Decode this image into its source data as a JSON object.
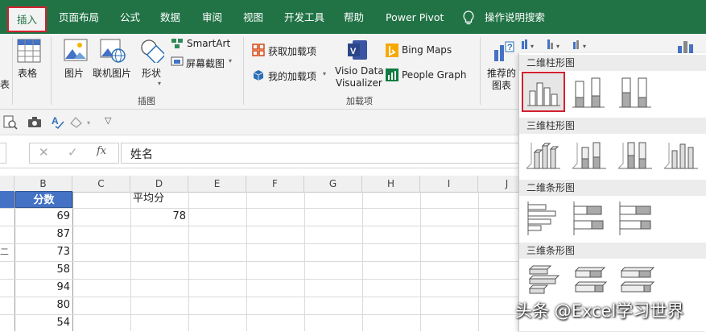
{
  "tabs": [
    "插入",
    "页面布局",
    "公式",
    "数据",
    "审阅",
    "视图",
    "开发工具",
    "帮助",
    "Power Pivot"
  ],
  "tell_me": "操作说明搜索",
  "ribbon": {
    "table_partial": "表",
    "table": "表格",
    "picture": "图片",
    "online_picture": "联机图片",
    "shapes": "形状",
    "smartart": "SmartArt",
    "screenshot": "屏幕截图",
    "group_illustrations": "插图",
    "get_addins": "获取加载项",
    "my_addins": "我的加载项",
    "visio_line1": "Visio Data",
    "visio_line2": "Visualizer",
    "bing_maps": "Bing Maps",
    "people_graph": "People Graph",
    "group_addins": "加载项",
    "recommended_line1": "推荐的",
    "recommended_line2": "图表"
  },
  "formula": {
    "fx": "fx",
    "value": "姓名"
  },
  "columns": [
    "B",
    "C",
    "D",
    "E",
    "F",
    "G",
    "H",
    "I",
    "J"
  ],
  "cells": {
    "b_header": "分数",
    "d_header": "平均分",
    "average": "78",
    "scores": [
      "69",
      "87",
      "73",
      "58",
      "94",
      "80",
      "54"
    ],
    "a_partial": "二"
  },
  "dropdown": {
    "sections": [
      "二维柱形图",
      "三维柱形图",
      "二维条形图",
      "三维条形图"
    ]
  },
  "watermark": "头条 @Excel学习世界",
  "colors": {
    "excel_green": "#217346",
    "highlight_red": "#d3202e",
    "header_blue": "#4472c4"
  }
}
